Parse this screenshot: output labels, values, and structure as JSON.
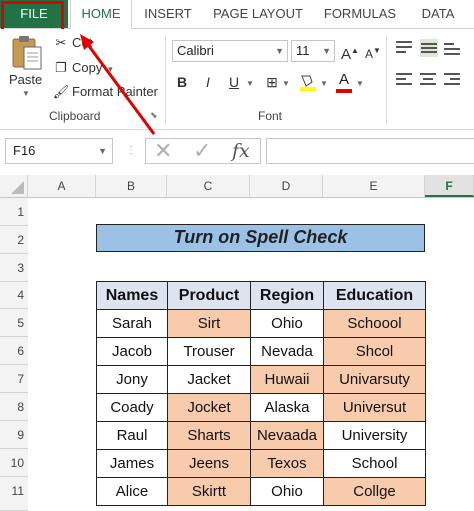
{
  "tabs": [
    "FILE",
    "HOME",
    "INSERT",
    "PAGE LAYOUT",
    "FORMULAS",
    "DATA"
  ],
  "ribbon": {
    "paste_label": "Paste",
    "cut_label": "Cut",
    "copy_label": "Copy",
    "format_painter_label": "Format Painter",
    "clipboard_group": "Clipboard",
    "font_name": "Calibri",
    "font_size": "11",
    "font_group": "Font",
    "bold": "B",
    "italic": "I",
    "underline": "U"
  },
  "formula_bar": {
    "name_box": "F16",
    "fx_label": "fx",
    "formula": ""
  },
  "columns": [
    "A",
    "B",
    "C",
    "D",
    "E",
    "F"
  ],
  "rows": [
    "1",
    "2",
    "3",
    "4",
    "5",
    "6",
    "7",
    "8",
    "9",
    "10",
    "11"
  ],
  "sheet": {
    "title": "Turn on Spell Check",
    "headers": [
      "Names",
      "Product",
      "Region",
      "Education"
    ],
    "records": [
      {
        "name": "Sarah",
        "product": "Sirt",
        "region": "Ohio",
        "education": "Schoool"
      },
      {
        "name": "Jacob",
        "product": "Trouser",
        "region": "Nevada",
        "education": "Shcol"
      },
      {
        "name": "Jony",
        "product": "Jacket",
        "region": "Huwaii",
        "education": "Univarsuty"
      },
      {
        "name": "Coady",
        "product": "Jocket",
        "region": "Alaska",
        "education": "Universut"
      },
      {
        "name": "Raul",
        "product": "Sharts",
        "region": "Nevaada",
        "education": "University"
      },
      {
        "name": "James",
        "product": "Jeens",
        "region": "Texos",
        "education": "School"
      },
      {
        "name": "Alice",
        "product": "Skirtt",
        "region": "Ohio",
        "education": "Collge"
      }
    ]
  },
  "colors": {
    "file_tab": "#217346",
    "annotation": "#e00000",
    "title_fill": "#9bc2e6",
    "misspelled_fill": "#f8cbad"
  }
}
